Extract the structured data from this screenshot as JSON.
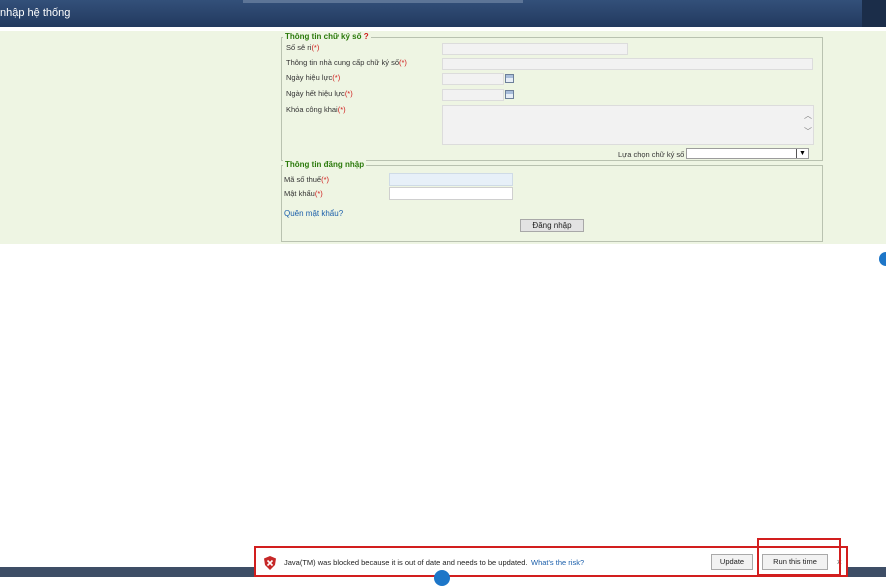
{
  "window": {
    "title": "nhập hệ thống"
  },
  "signature": {
    "legend": "Thông tin chữ ký số",
    "help_mark": "?",
    "serial_label": "Số sê ri",
    "provider_label": "Thông tin nhà cung cấp chữ ký số",
    "valid_from_label": "Ngày hiệu lực",
    "valid_to_label": "Ngày hết hiệu lực",
    "public_key_label": "Khóa công khai",
    "select_label": "Lựa chọn chữ ký số",
    "required_mark": "(*)"
  },
  "login": {
    "legend": "Thông tin đăng nhập",
    "tax_code_label": "Mã số thuế",
    "password_label": "Mật khẩu",
    "forgot_link": "Quên mật khẩu?",
    "submit_label": "Đăng nhập"
  },
  "notification": {
    "message": "Java(TM) was blocked because it is out of date and needs to be updated.",
    "risk_link": "What's the risk?",
    "update_label": "Update",
    "run_label": "Run this time",
    "close_glyph": "×"
  },
  "colors": {
    "title_bar": "#22395e",
    "form_background": "#eef5e3",
    "legend_text": "#2b7a0b",
    "required": "#d01818",
    "link": "#1b5fab",
    "highlight": "#d21e1e"
  },
  "icons": [
    "calendar-icon",
    "shield-blocked-icon",
    "close-icon",
    "chevron-down-icon",
    "scroll-up-icon",
    "scroll-down-icon"
  ]
}
